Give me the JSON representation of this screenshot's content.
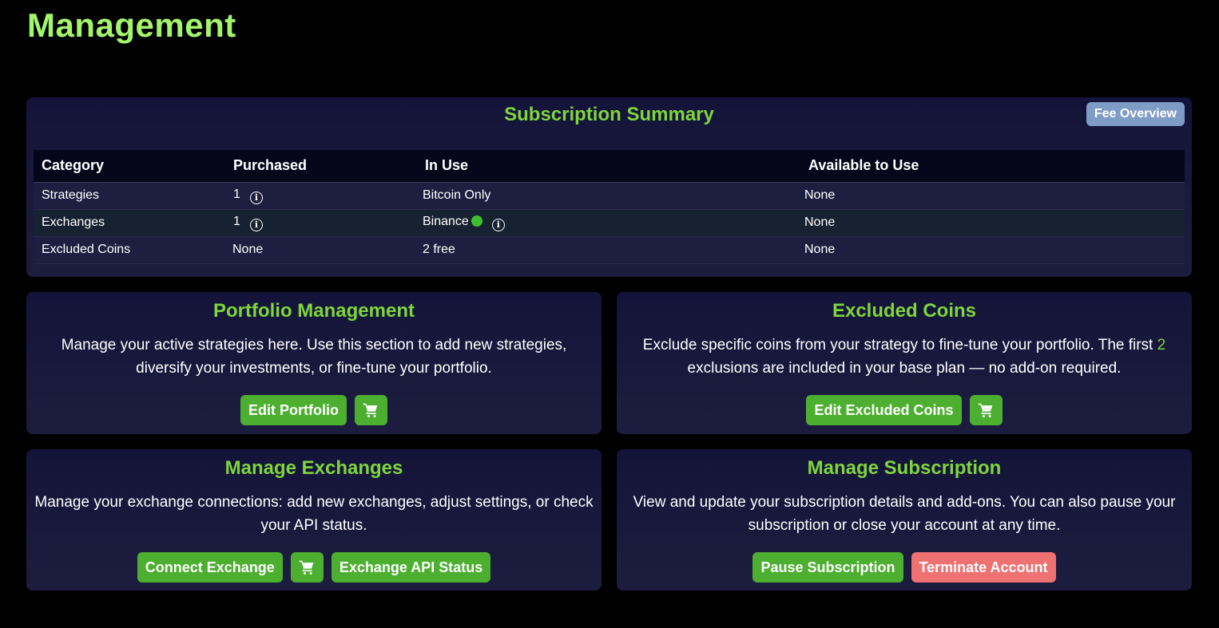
{
  "page": {
    "title": "Management"
  },
  "summary": {
    "title": "Subscription Summary",
    "fee_button": "Fee Overview",
    "headers": [
      "Category",
      "Purchased",
      "In Use",
      "Available to Use"
    ],
    "rows": [
      {
        "category": "Strategies",
        "purchased": "1",
        "in_use": "Bitcoin Only",
        "available": "None"
      },
      {
        "category": "Exchanges",
        "purchased": "1",
        "in_use": "Binance",
        "available": "None"
      },
      {
        "category": "Excluded Coins",
        "purchased": "None",
        "in_use": "2 free",
        "available": "None"
      }
    ]
  },
  "portfolio": {
    "title": "Portfolio Management",
    "description": "Manage your active strategies here. Use this section to add new strategies, diversify your investments, or fine-tune your portfolio.",
    "edit_button": "Edit Portfolio"
  },
  "excluded": {
    "title": "Excluded Coins",
    "description_before": "Exclude specific coins from your strategy to fine-tune your portfolio. The first ",
    "free_count": "2",
    "description_after": " exclusions are included in your base plan — no add-on required.",
    "edit_button": "Edit Excluded Coins"
  },
  "exchanges": {
    "title": "Manage Exchanges",
    "description": "Manage your exchange connections: add new exchanges, adjust settings, or check your API status.",
    "connect_button": "Connect Exchange",
    "status_button": "Exchange API Status"
  },
  "subscription": {
    "title": "Manage Subscription",
    "description": "View and update your subscription details and add-ons. You can also pause your subscription or close your account at any time.",
    "pause_button": "Pause Subscription",
    "terminate_button": "Terminate Account"
  },
  "colors": {
    "accent": "#7fd63a",
    "title": "#a3f56b",
    "button": "#4caf2f",
    "danger": "#f07171",
    "fee_button": "#7e9cc5",
    "status_connected": "#3fbf2f"
  },
  "icons": {
    "cart": "shopping-cart-icon",
    "info": "info-icon",
    "status": "connected-status-dot"
  }
}
